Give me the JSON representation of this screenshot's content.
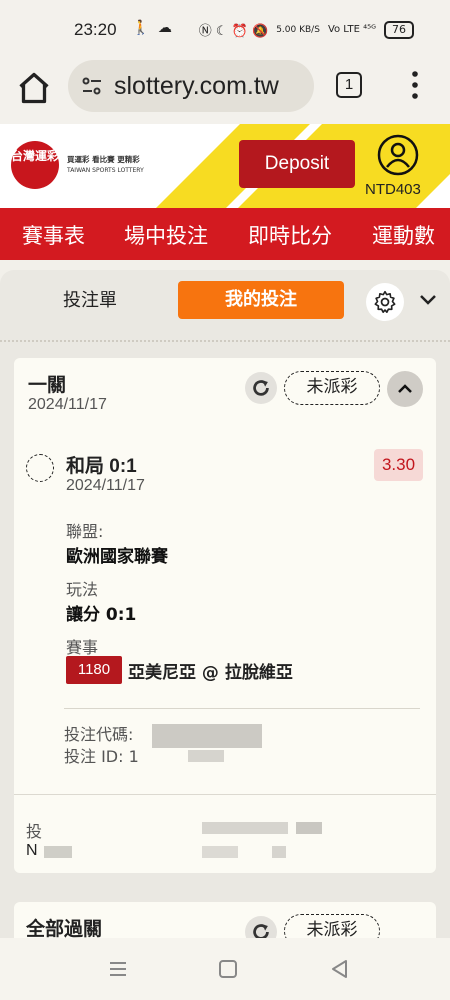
{
  "status_bar": {
    "time": "23:20",
    "left_icons": "🚶 ☁",
    "net_speed": "5.00 KB/S",
    "network": "Vo LTE ⁴⁵ᴳ",
    "battery": "76"
  },
  "browser": {
    "url": "slottery.com.tw",
    "tab_count": "1"
  },
  "header": {
    "logo_text": "台灣運彩",
    "logo_slogan": "買運彩  看比賽  更精彩",
    "logo_english": "TAIWAN SPORTS LOTTERY",
    "deposit_label": "Deposit",
    "balance": "NTD403"
  },
  "nav": {
    "items": [
      "賽事表",
      "場中投注",
      "即時比分",
      "運動數"
    ]
  },
  "betslip": {
    "tab_betslip": "投注單",
    "tab_mybets": "我的投注"
  },
  "bet": {
    "type": "一關",
    "date": "2024/11/17",
    "status": "未派彩",
    "selection": {
      "name": "和局 0:1",
      "date": "2024/11/17",
      "odds": "3.30",
      "league_label": "聯盟:",
      "league": "歐洲國家聯賽",
      "market_label": "玩法",
      "market": "讓分 0:1",
      "event_label": "賽事",
      "event_id": "1180",
      "event_name": "亞美尼亞 @ 拉脫維亞"
    },
    "bet_code_label": "投注代碼:",
    "bet_id_label": "投注 ID: 1",
    "stake_label": "投",
    "stake_value": "N"
  },
  "bet2": {
    "type": "全部過關",
    "status": "未派彩"
  },
  "colors": {
    "brand_red": "#d31a20",
    "orange": "#f7740f",
    "yellow": "#f7dc22"
  }
}
